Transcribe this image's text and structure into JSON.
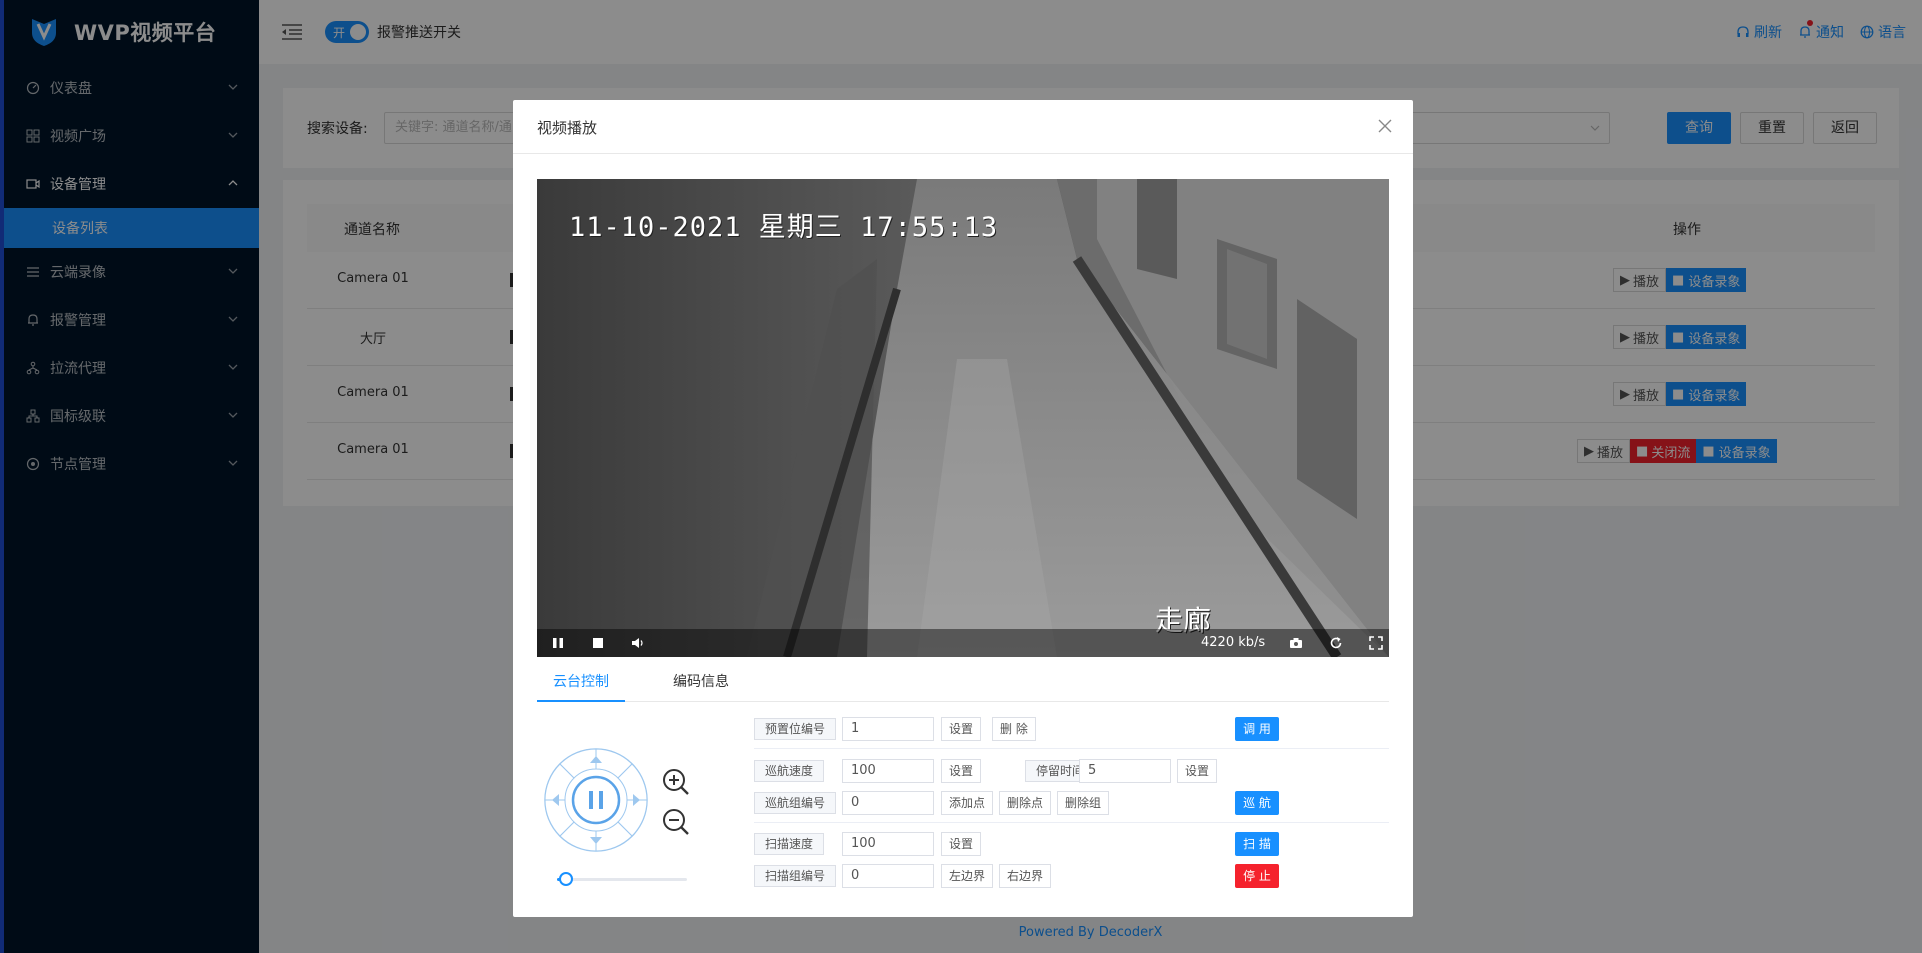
{
  "app": {
    "title": "WVP视频平台"
  },
  "sidebar": {
    "items": [
      {
        "label": "仪表盘",
        "icon": "dashboard-icon"
      },
      {
        "label": "视频广场",
        "icon": "grid-icon"
      },
      {
        "label": "设备管理",
        "icon": "video-camera-icon",
        "open": true,
        "children": [
          {
            "label": "设备列表",
            "active": true
          }
        ]
      },
      {
        "label": "云端录像",
        "icon": "list-icon"
      },
      {
        "label": "报警管理",
        "icon": "bell-icon"
      },
      {
        "label": "拉流代理",
        "icon": "branch-icon"
      },
      {
        "label": "国标级联",
        "icon": "cluster-icon"
      },
      {
        "label": "节点管理",
        "icon": "node-icon"
      }
    ]
  },
  "header": {
    "toggle_text": "开",
    "toggle_label": "报警推送开关",
    "refresh": "刷新",
    "notify": "通知",
    "language": "语言"
  },
  "search": {
    "label": "搜索设备:",
    "placeholder": "关键字: 通道名称/通",
    "query": "查询",
    "reset": "重置",
    "back": "返回"
  },
  "table": {
    "col_name": "通道名称",
    "col_ops": "操作",
    "rows": [
      {
        "name": "Camera 01",
        "ops": [
          "播放",
          "设备录象"
        ]
      },
      {
        "name": "大厅",
        "ops": [
          "播放",
          "设备录象"
        ]
      },
      {
        "name": "Camera 01",
        "ops": [
          "播放",
          "设备录象"
        ]
      },
      {
        "name": "Camera 01",
        "ops": [
          "播放",
          "关闭流",
          "设备录象"
        ]
      }
    ]
  },
  "footer": "Powered By DecoderX",
  "modal": {
    "title": "视频播放",
    "osd_timestamp": "11-10-2021 星期三 17:55:13",
    "camera_label": "走廊",
    "bitrate": "4220 kb/s",
    "tabs": [
      "云台控制",
      "编码信息"
    ],
    "active_tab": 0,
    "ptz": {
      "zoom_level": 0.07,
      "preset": {
        "label": "预置位编号",
        "value": "1",
        "set": "设置",
        "delete": "删 除",
        "call": "调 用"
      },
      "cruise_speed": {
        "label": "巡航速度",
        "value": "100",
        "set": "设置"
      },
      "dwell": {
        "label": "停留时间",
        "value": "5",
        "set": "设置"
      },
      "cruise_group": {
        "label": "巡航组编号",
        "value": "0",
        "add_point": "添加点",
        "delete_point": "删除点",
        "delete_group": "删除组",
        "cruise": "巡 航"
      },
      "scan_speed": {
        "label": "扫描速度",
        "value": "100",
        "set": "设置",
        "scan": "扫 描"
      },
      "scan_group": {
        "label": "扫描组编号",
        "value": "0",
        "left": "左边界",
        "right": "右边界",
        "stop": "停 止"
      }
    }
  }
}
